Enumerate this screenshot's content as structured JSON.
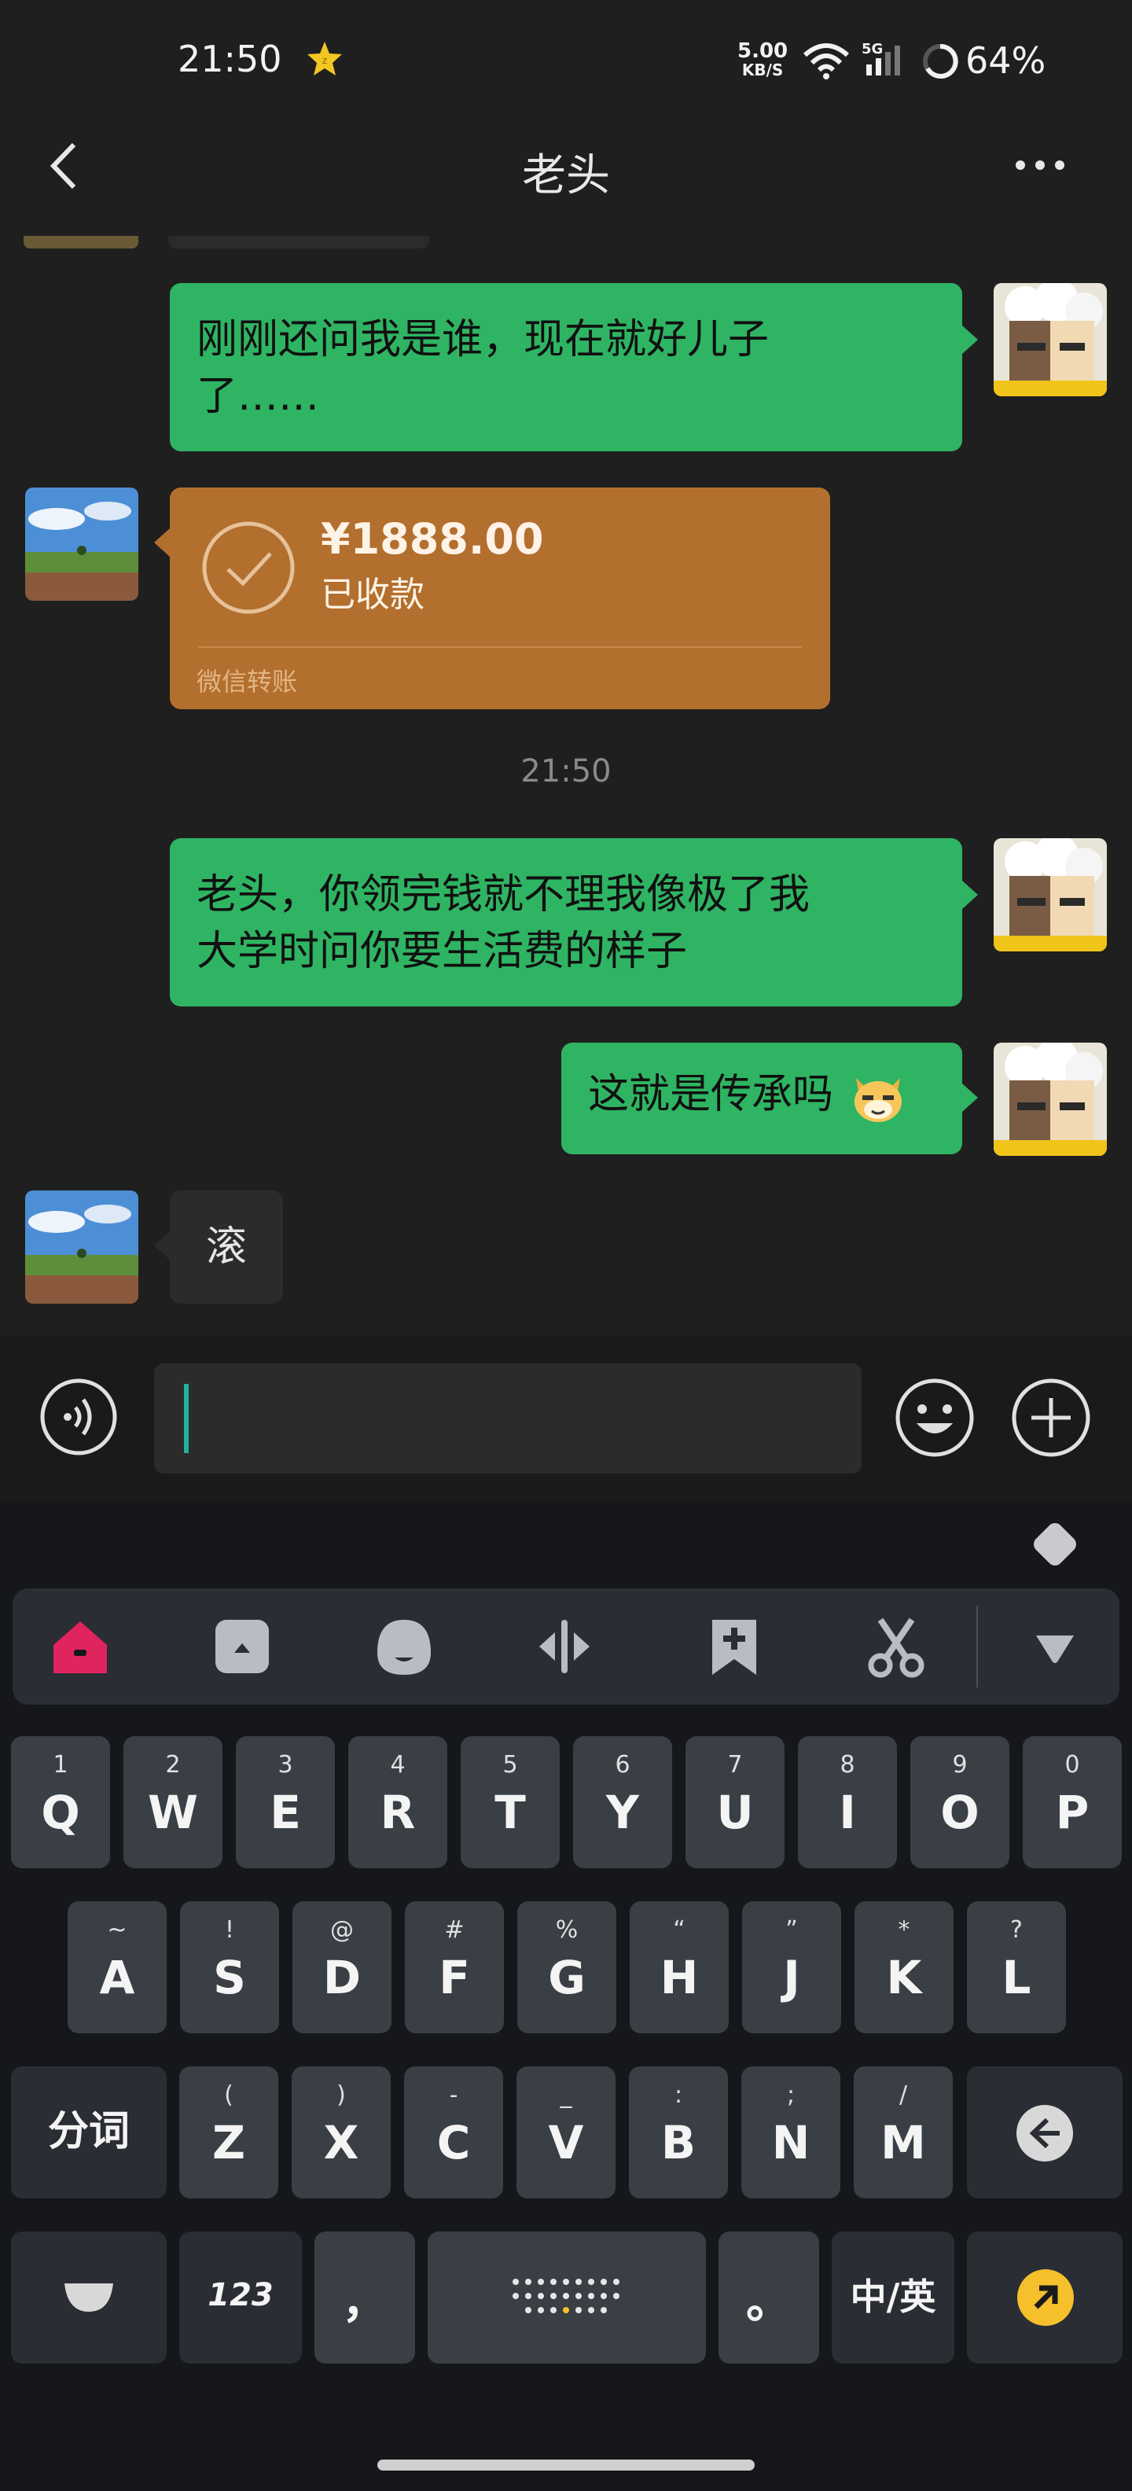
{
  "status_bar": {
    "time": "21:50",
    "net_speed_value": "5.00",
    "net_speed_unit": "KB/S",
    "signal_label": "5G",
    "battery": "64%"
  },
  "header": {
    "title": "老头",
    "back_icon": "chevron-left-icon",
    "more_icon": "more-dots-icon"
  },
  "messages": [
    {
      "sender": "me",
      "text_line1": "刚刚还问我是谁，现在就好儿子",
      "text_line2": "了……"
    },
    {
      "sender": "other",
      "type": "transfer",
      "amount": "¥1888.00",
      "status": "已收款",
      "footer": "微信转账",
      "color": "#b36f2d"
    },
    {
      "sender": "system",
      "type": "timestamp",
      "text": "21:50"
    },
    {
      "sender": "me",
      "text_line1": "老头，你领完钱就不理我像极了我",
      "text_line2": "大学时问你要生活费的样子"
    },
    {
      "sender": "me",
      "text": "这就是传承吗"
    },
    {
      "sender": "other",
      "text": "滚"
    }
  ],
  "input_bar": {
    "voice_icon": "voice-icon",
    "emoji_icon": "emoji-icon",
    "plus_icon": "plus-icon",
    "value": ""
  },
  "keyboard": {
    "row1": [
      {
        "sub": "1",
        "main": "Q"
      },
      {
        "sub": "2",
        "main": "W"
      },
      {
        "sub": "3",
        "main": "E"
      },
      {
        "sub": "4",
        "main": "R"
      },
      {
        "sub": "5",
        "main": "T"
      },
      {
        "sub": "6",
        "main": "Y"
      },
      {
        "sub": "7",
        "main": "U"
      },
      {
        "sub": "8",
        "main": "I"
      },
      {
        "sub": "9",
        "main": "O"
      },
      {
        "sub": "0",
        "main": "P"
      }
    ],
    "row2": [
      {
        "sub": "~",
        "main": "A"
      },
      {
        "sub": "!",
        "main": "S"
      },
      {
        "sub": "@",
        "main": "D"
      },
      {
        "sub": "#",
        "main": "F"
      },
      {
        "sub": "%",
        "main": "G"
      },
      {
        "sub": "“",
        "main": "H"
      },
      {
        "sub": "”",
        "main": "J"
      },
      {
        "sub": "*",
        "main": "K"
      },
      {
        "sub": "?",
        "main": "L"
      }
    ],
    "row3_left": "分词",
    "row3": [
      {
        "sub": "(",
        "main": "Z"
      },
      {
        "sub": ")",
        "main": "X"
      },
      {
        "sub": "-",
        "main": "C"
      },
      {
        "sub": "_",
        "main": "V"
      },
      {
        "sub": ":",
        "main": "B"
      },
      {
        "sub": ";",
        "main": "N"
      },
      {
        "sub": "/",
        "main": "M"
      }
    ],
    "num_key": "123",
    "comma_key": "，",
    "period_key": "。",
    "lang_key": "中/英"
  },
  "colors": {
    "bubble_green": "#2fb463",
    "bubble_dark": "#2b2b2b",
    "transfer": "#b36f2d",
    "accent_pink": "#e0245e",
    "accent_yellow": "#f5c02c"
  }
}
